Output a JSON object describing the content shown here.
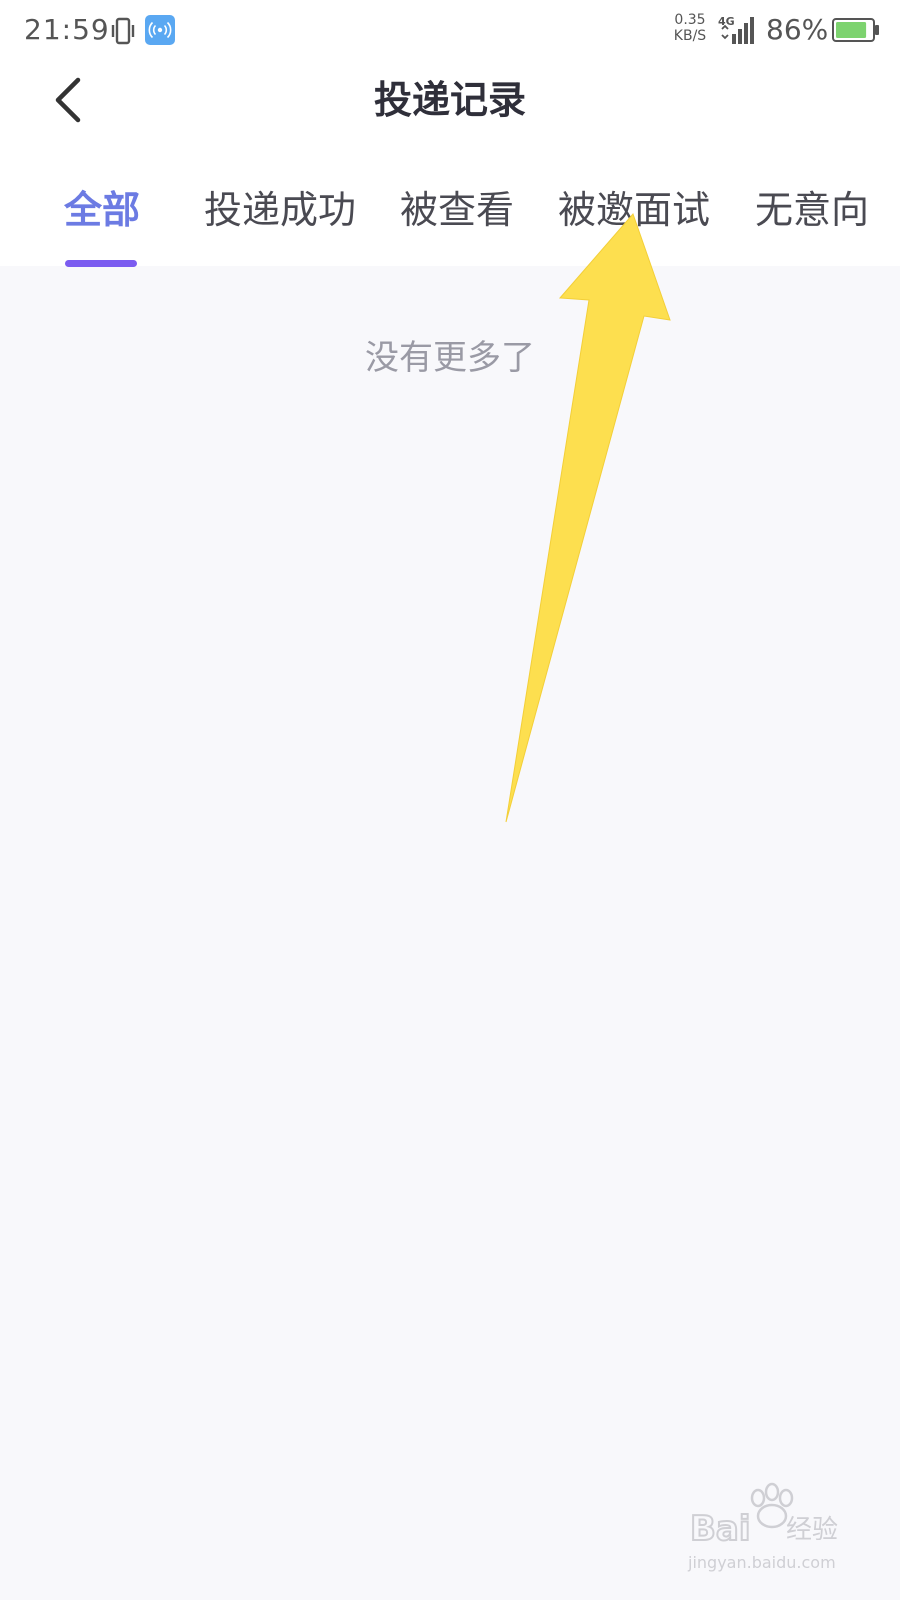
{
  "status_bar": {
    "time": "21:59",
    "net_speed_value": "0.35",
    "net_speed_unit": "KB/S",
    "network_type": "4G",
    "battery_percent": "86%",
    "hotspot_color": "#5aa8f2",
    "battery_color": "#7dd36f"
  },
  "nav": {
    "title": "投递记录",
    "back_icon": "chevron-left-icon"
  },
  "tabs": [
    {
      "label": "全部",
      "active": true
    },
    {
      "label": "投递成功",
      "active": false
    },
    {
      "label": "被查看",
      "active": false
    },
    {
      "label": "被邀面试",
      "active": false
    },
    {
      "label": "无意向",
      "active": false
    }
  ],
  "colors": {
    "active_tab": "#6c7be3",
    "indicator": "#7b5cf0",
    "arrow": "#fddf4f",
    "background": "#f8f8fb"
  },
  "content": {
    "empty_text": "没有更多了"
  },
  "watermark": {
    "brand": "Bai",
    "brand_suffix": "经验",
    "url": "jingyan.baidu.com"
  }
}
